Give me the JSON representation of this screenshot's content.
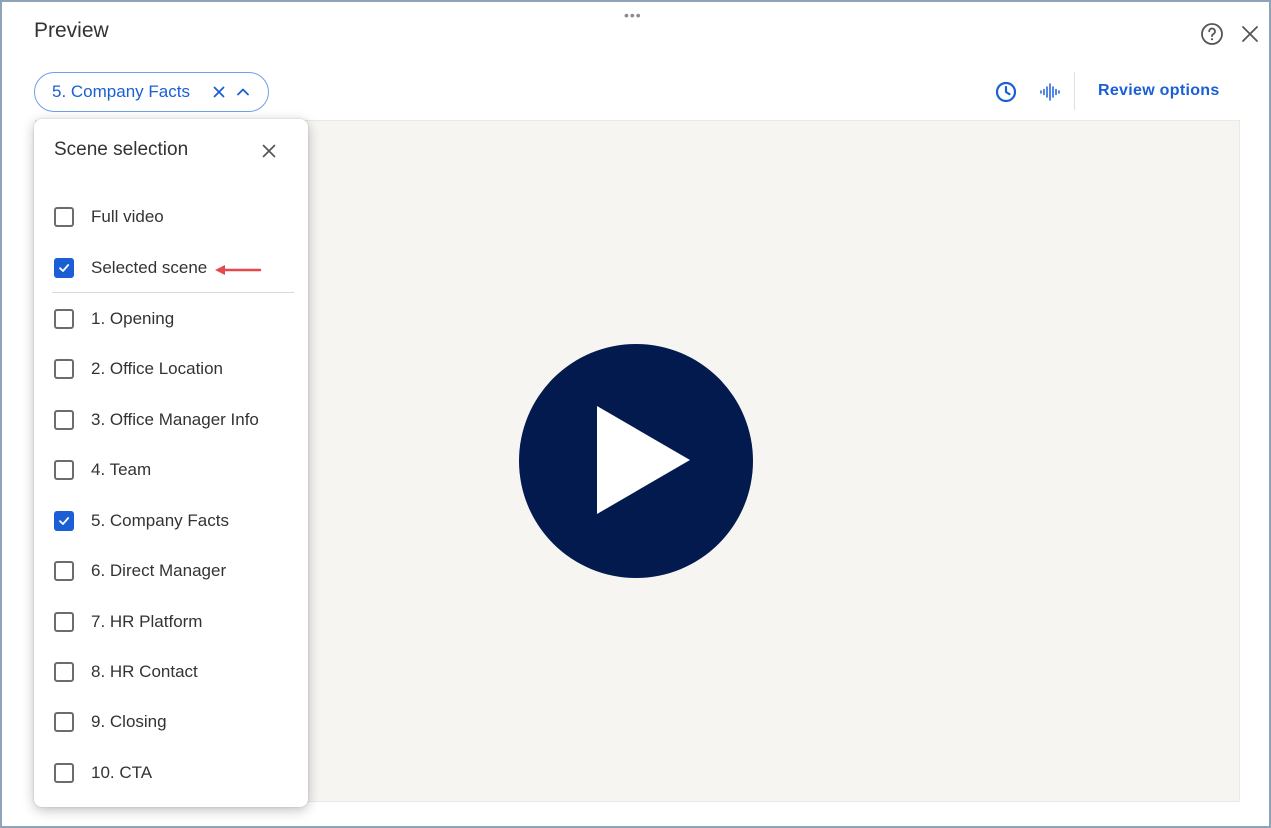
{
  "window": {
    "title": "Preview",
    "drag_handle": "•••"
  },
  "chip": {
    "label": "5. Company Facts"
  },
  "toolbar": {
    "review_options": "Review options"
  },
  "panel": {
    "title": "Scene selection",
    "options": [
      {
        "label": "Full video",
        "checked": false
      },
      {
        "label": "Selected scene",
        "checked": true
      },
      {
        "label": "1. Opening",
        "checked": false
      },
      {
        "label": "2. Office Location",
        "checked": false
      },
      {
        "label": "3. Office Manager Info",
        "checked": false
      },
      {
        "label": "4. Team",
        "checked": false
      },
      {
        "label": "5. Company Facts",
        "checked": true
      },
      {
        "label": "6. Direct Manager",
        "checked": false
      },
      {
        "label": "7. HR Platform",
        "checked": false
      },
      {
        "label": "8. HR Contact",
        "checked": false
      },
      {
        "label": "9. Closing",
        "checked": false
      },
      {
        "label": "10. CTA",
        "checked": false
      }
    ]
  },
  "colors": {
    "accent": "#1a5fd6",
    "play_button": "#031a4f",
    "video_bg": "#f6f5f2",
    "annotation_arrow": "#e5484d"
  },
  "icons": {
    "help": "help-circle-icon",
    "close": "close-icon",
    "history": "clock-icon",
    "audio": "audio-waveform-icon",
    "play": "play-icon",
    "chip_clear": "x-icon",
    "chip_toggle": "chevron-up-icon",
    "checkmark": "checkmark-icon"
  }
}
